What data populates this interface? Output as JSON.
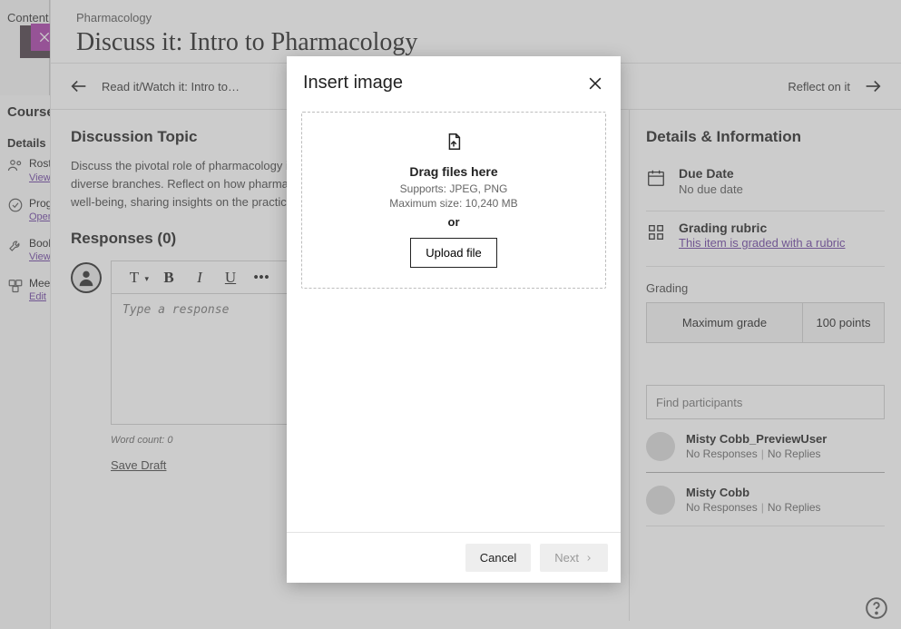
{
  "far_left": {
    "tab": "Content"
  },
  "sidebar": {
    "header": "Course",
    "section": "Details",
    "items": [
      {
        "label": "Roster",
        "sub": "View"
      },
      {
        "label": "Progress",
        "sub": "Open"
      },
      {
        "label": "Books",
        "sub": "View"
      },
      {
        "label": "Meetings",
        "sub": "Edit"
      }
    ]
  },
  "header": {
    "crumb": "Pharmacology",
    "title": "Discuss it: Intro to Pharmacology"
  },
  "nav": {
    "prev": "Read it/Watch it: Intro to…",
    "next": "Reflect on it"
  },
  "topic": {
    "heading": "Discussion Topic",
    "body": "Discuss the pivotal role of pharmacology in healthcare, delving into its historical development and diverse branches. Reflect on how pharmacological knowledge influences drug therapy and patient well-being, sharing insights on the practical applications within clinical practice."
  },
  "responses": {
    "heading": "Responses (0)"
  },
  "editor": {
    "placeholder": "Type a response",
    "word_count": "Word count: 0",
    "save_draft": "Save Draft",
    "t_text": "T",
    "t_bold": "B",
    "t_italic": "I",
    "t_under": "U",
    "t_more": "•••"
  },
  "details": {
    "heading": "Details & Information",
    "due": {
      "label": "Due Date",
      "value": "No due date"
    },
    "rubric": {
      "label": "Grading rubric",
      "link": "This item is graded with a rubric"
    },
    "grading_h": "Grading",
    "max_label": "Maximum grade",
    "points": "100 points"
  },
  "participants": {
    "find_placeholder": "Find participants",
    "rows": [
      {
        "name": "Misty Cobb_PreviewUser",
        "responses": "No Responses",
        "replies": "No Replies"
      },
      {
        "name": "Misty Cobb",
        "responses": "No Responses",
        "replies": "No Replies"
      }
    ]
  },
  "modal": {
    "title": "Insert image",
    "drop_h": "Drag files here",
    "supports": "Supports: JPEG, PNG",
    "maxsize": "Maximum size: 10,240 MB",
    "or": "or",
    "upload": "Upload file",
    "cancel": "Cancel",
    "next": "Next"
  }
}
